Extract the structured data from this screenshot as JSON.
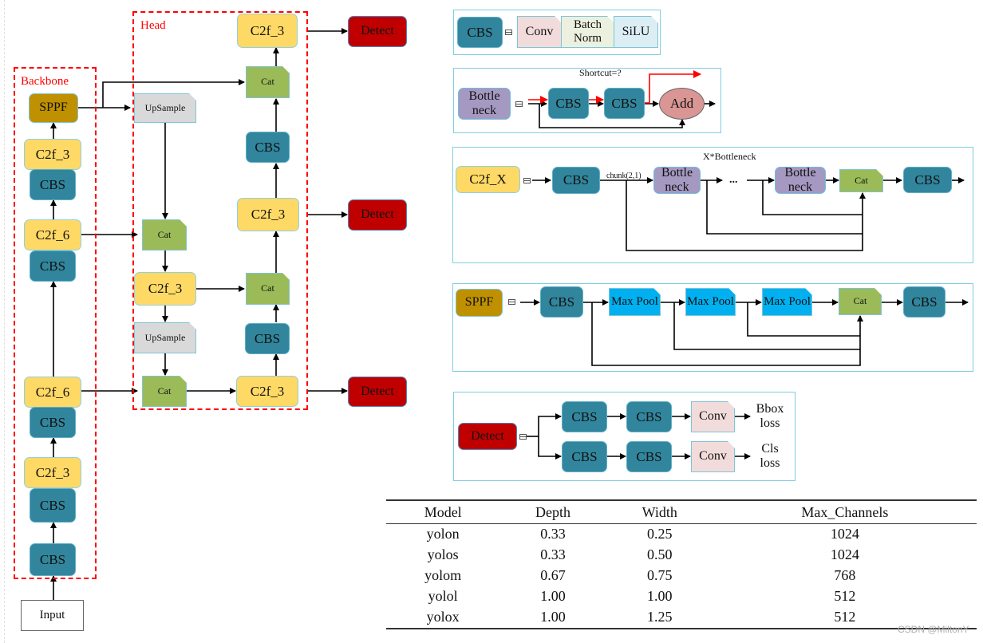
{
  "diagram": {
    "backbone": {
      "title": "Backbone",
      "nodes": [
        "SPPF",
        "C2f_3",
        "CBS",
        "C2f_6",
        "CBS",
        "C2f_6",
        "CBS",
        "C2f_3",
        "CBS",
        "CBS"
      ],
      "input": "Input"
    },
    "head": {
      "title": "Head",
      "upsample": "UpSample",
      "cat": "Cat",
      "c2f3": "C2f_3",
      "cbs": "CBS",
      "detect": "Detect"
    },
    "cbs_def": {
      "name": "CBS",
      "parts": [
        "Conv",
        "Batch Norm",
        "SiLU"
      ]
    },
    "bottleneck_def": {
      "name": "Bottle neck",
      "caption": "Shortcut=?",
      "blocks": [
        "CBS",
        "CBS"
      ],
      "add": "Add"
    },
    "c2f_def": {
      "name": "C2f_X",
      "caption": "X*Bottleneck",
      "chunk": "chunk(2,1)",
      "ellipsis": "...",
      "cbs": "CBS",
      "bottleneck": "Bottle neck",
      "cat": "Cat"
    },
    "sppf_def": {
      "name": "SPPF",
      "cbs": "CBS",
      "maxpool": "Max Pool",
      "cat": "Cat"
    },
    "detect_def": {
      "name": "Detect",
      "cbs": "CBS",
      "conv": "Conv",
      "outputs": [
        "Bbox loss",
        "Cls loss"
      ]
    }
  },
  "table": {
    "headers": [
      "Model",
      "Depth",
      "Width",
      "Max_Channels"
    ],
    "rows": [
      [
        "yolon",
        "0.33",
        "0.25",
        "1024"
      ],
      [
        "yolos",
        "0.33",
        "0.50",
        "1024"
      ],
      [
        "yolom",
        "0.67",
        "0.75",
        "768"
      ],
      [
        "yolol",
        "1.00",
        "1.00",
        "512"
      ],
      [
        "yolox",
        "1.00",
        "1.25",
        "512"
      ]
    ]
  },
  "watermark": "CSDN @MiltonY"
}
